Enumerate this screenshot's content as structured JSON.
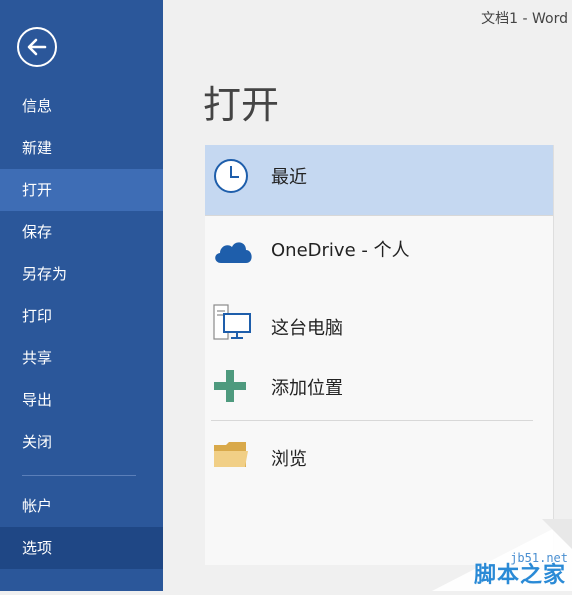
{
  "window": {
    "title": "文档1 - Word"
  },
  "sidebar": {
    "items": [
      {
        "label": "信息"
      },
      {
        "label": "新建"
      },
      {
        "label": "打开"
      },
      {
        "label": "保存"
      },
      {
        "label": "另存为"
      },
      {
        "label": "打印"
      },
      {
        "label": "共享"
      },
      {
        "label": "导出"
      },
      {
        "label": "关闭"
      },
      {
        "label": "帐户"
      },
      {
        "label": "选项"
      }
    ],
    "active": "打开",
    "hovered": "选项"
  },
  "main": {
    "title": "打开",
    "places": [
      {
        "label": "最近",
        "icon": "clock-icon",
        "selected": true
      },
      {
        "label": "OneDrive - 个人",
        "icon": "cloud-icon"
      },
      {
        "label": "这台电脑",
        "icon": "computer-icon"
      },
      {
        "label": "添加位置",
        "icon": "plus-icon"
      },
      {
        "label": "浏览",
        "icon": "folder-icon"
      }
    ]
  },
  "watermark": {
    "site": "jb51.net",
    "brand": "脚本之家"
  },
  "colors": {
    "sidebar": "#2b579a",
    "sidebar_active": "#3e6db5",
    "selected_place": "#c5d8f1",
    "cloud": "#1e5eab",
    "plus": "#4e9a7e",
    "folder": "#e8c479"
  }
}
